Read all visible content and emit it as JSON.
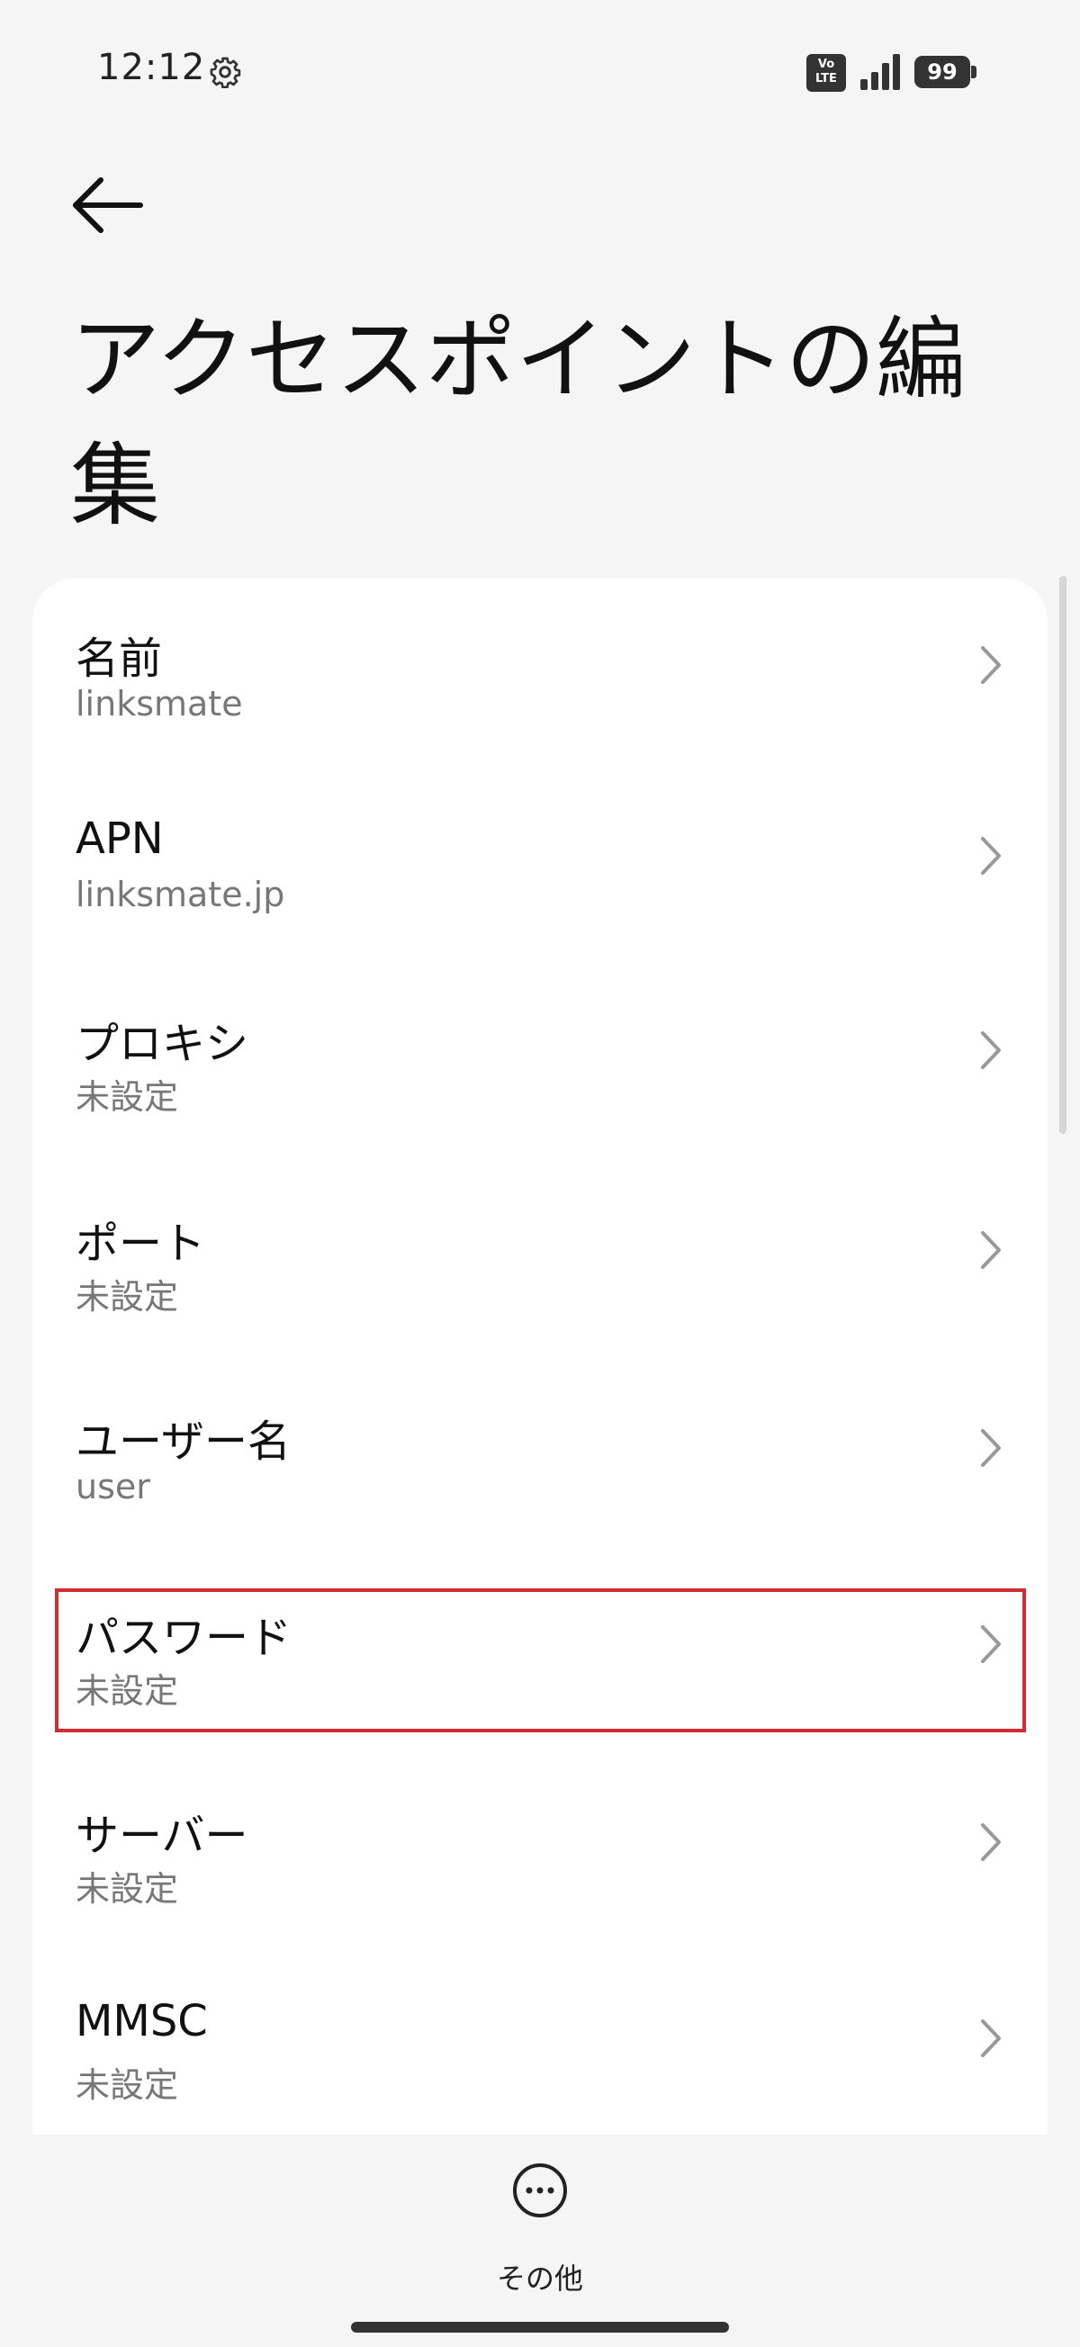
{
  "status_bar": {
    "time": "12:12",
    "network_badge": "VoLTE",
    "battery_level": "99"
  },
  "header": {
    "title": "アクセスポイントの編集"
  },
  "list": {
    "items": [
      {
        "title": "名前",
        "value": "linksmate"
      },
      {
        "title": "APN",
        "value": "linksmate.jp"
      },
      {
        "title": "プロキシ",
        "value": "未設定"
      },
      {
        "title": "ポート",
        "value": "未設定"
      },
      {
        "title": "ユーザー名",
        "value": "user"
      },
      {
        "title": "パスワード",
        "value": "未設定"
      },
      {
        "title": "サーバー",
        "value": "未設定"
      },
      {
        "title": "MMSC",
        "value": "未設定"
      }
    ],
    "highlighted_item": "パスワード"
  },
  "bottom_bar": {
    "more_label": "その他"
  },
  "colors": {
    "background": "#f5f5f5",
    "card": "#ffffff",
    "highlight": "#d22c35",
    "secondary_text": "#777777"
  },
  "icons": {
    "status_gear": "gear-icon",
    "back": "arrow-left-icon",
    "chevron": "chevron-right-icon",
    "more": "more-horizontal-circle-icon"
  }
}
